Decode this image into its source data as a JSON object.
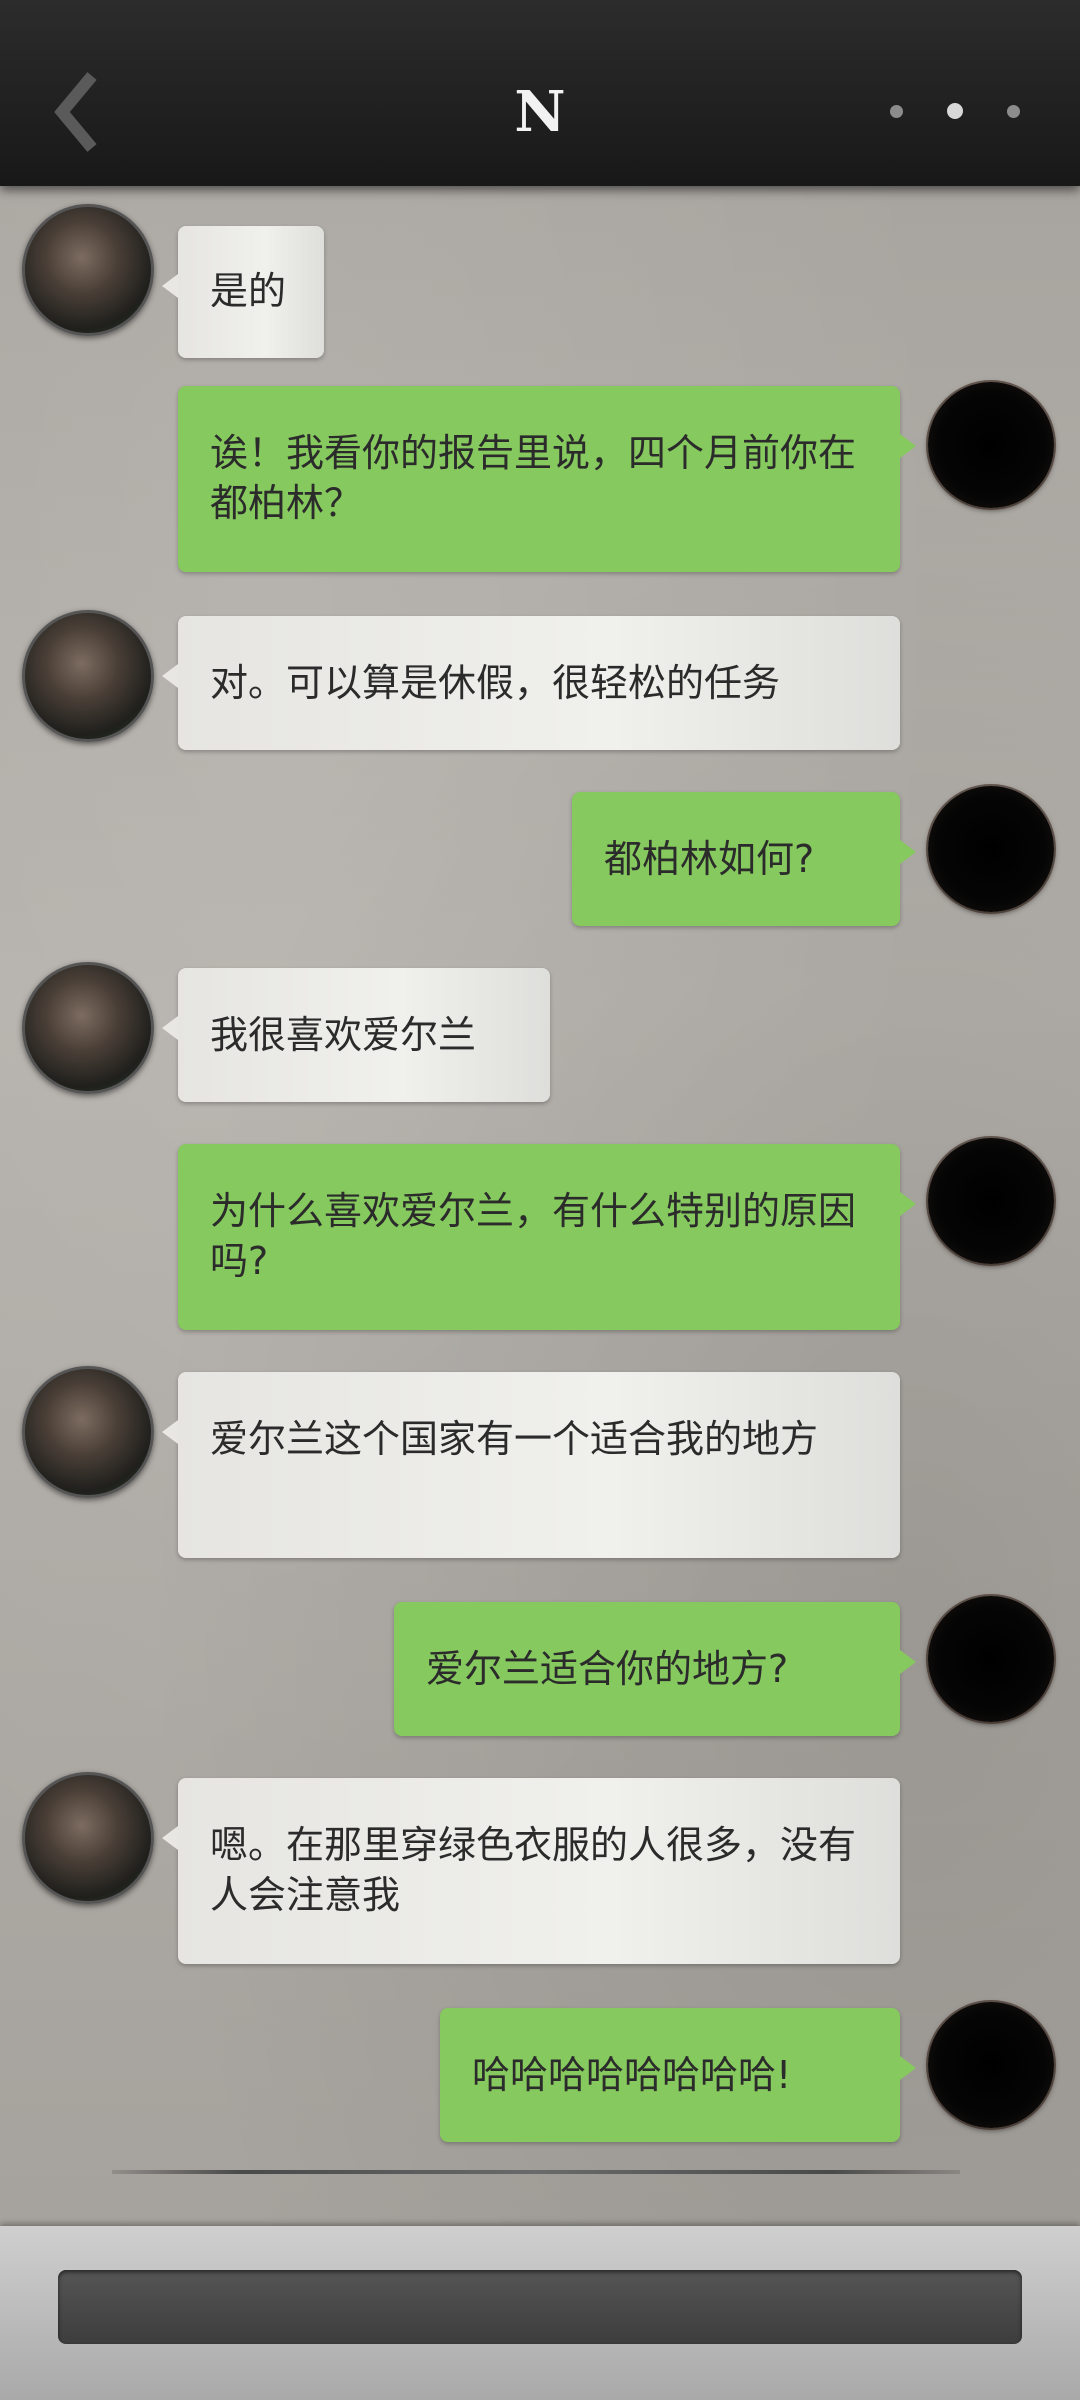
{
  "header": {
    "title": "N",
    "back_icon": "chevron-left-icon",
    "more_icon": "more-horizontal-icon"
  },
  "messages": [
    {
      "sender": "them",
      "text": "是的"
    },
    {
      "sender": "me",
      "text": "诶！我看你的报告里说，四个月前你在都柏林？"
    },
    {
      "sender": "them",
      "text": "对。可以算是休假，很轻松的任务"
    },
    {
      "sender": "me",
      "text": "都柏林如何?"
    },
    {
      "sender": "them",
      "text": "我很喜欢爱尔兰"
    },
    {
      "sender": "me",
      "text": "为什么喜欢爱尔兰，有什么特别的原因吗?"
    },
    {
      "sender": "them",
      "text": "爱尔兰这个国家有一个适合我的地方"
    },
    {
      "sender": "me",
      "text": "爱尔兰适合你的地方?"
    },
    {
      "sender": "them",
      "text": "嗯。在那里穿绿色衣服的人很多，没有人会注意我"
    },
    {
      "sender": "me",
      "text": "哈哈哈哈哈哈哈哈!"
    }
  ],
  "colors": {
    "header_bg": "#1f1f1f",
    "me_bubble": "#86c95e",
    "them_bubble": "#ebeae6",
    "background": "#aaa6a1",
    "input_bg": "#474747"
  }
}
